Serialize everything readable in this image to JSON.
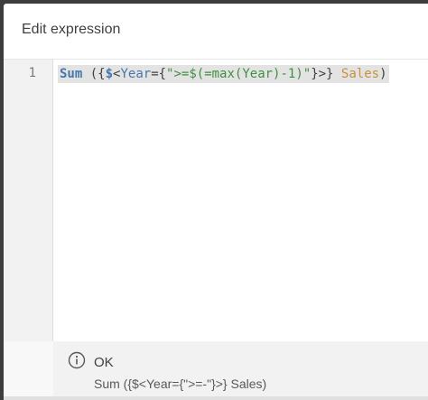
{
  "dialog": {
    "title": "Edit expression"
  },
  "editor": {
    "line_number": "1",
    "tokens": {
      "fn": "Sum",
      "open": " ({",
      "dollar": "$",
      "lt": "<",
      "field": "Year",
      "eq_brace": "={",
      "string": "\">=$(=max(Year)-1)\"",
      "close": "}>} ",
      "sales": "Sales",
      "paren": ")"
    }
  },
  "footer": {
    "status": "OK",
    "expression_preview": "Sum ({$<Year={\">=-\"}>} Sales)",
    "icon": "info-icon"
  },
  "colors": {
    "function": "#4477aa",
    "string": "#3f8f3f",
    "field_sales": "#c8913b",
    "selection": "#e3e3e3",
    "backdrop": "#3d3d3d"
  }
}
